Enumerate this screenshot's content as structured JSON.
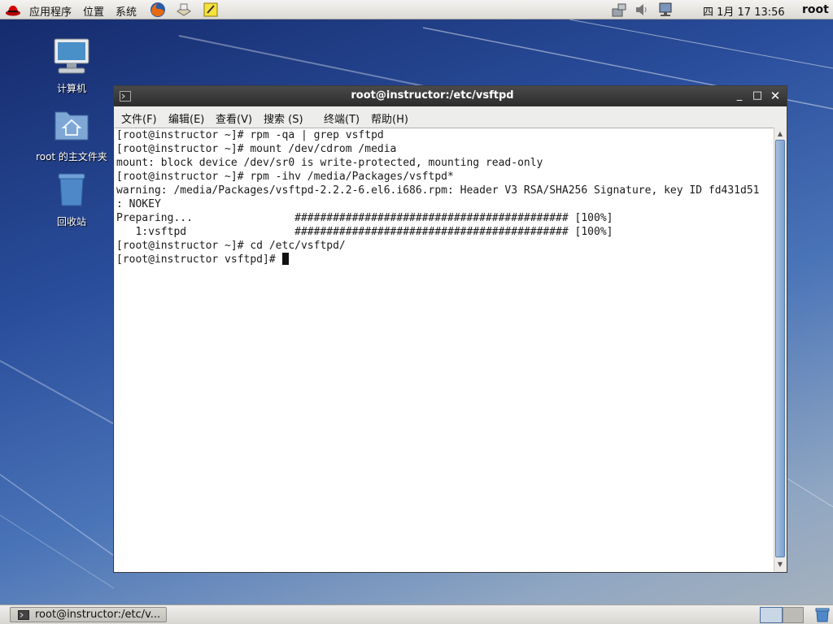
{
  "top_panel": {
    "menus": [
      "应用程序",
      "位置",
      "系统"
    ],
    "clock": "四  1月 17 13:56",
    "user": "root"
  },
  "desktop": {
    "icons": [
      {
        "label": "计算机",
        "icon": "computer-icon"
      },
      {
        "label": "root 的主文件夹",
        "icon": "home-folder-icon"
      },
      {
        "label": "回收站",
        "icon": "trash-icon"
      }
    ]
  },
  "terminal": {
    "title": "root@instructor:/etc/vsftpd",
    "menus": [
      "文件(F)",
      "编辑(E)",
      "查看(V)",
      "搜索 (S)",
      "终端(T)",
      "帮助(H)"
    ],
    "lines": [
      "[root@instructor ~]# rpm -qa | grep vsftpd",
      "[root@instructor ~]# mount /dev/cdrom /media",
      "mount: block device /dev/sr0 is write-protected, mounting read-only",
      "[root@instructor ~]# rpm -ihv /media/Packages/vsftpd*",
      "warning: /media/Packages/vsftpd-2.2.2-6.el6.i686.rpm: Header V3 RSA/SHA256 Signature, key ID fd431d51",
      ": NOKEY",
      "Preparing...                ########################################### [100%]",
      "   1:vsftpd                 ########################################### [100%]",
      "[root@instructor ~]# cd /etc/vsftpd/"
    ],
    "prompt": "[root@instructor vsftpd]# "
  },
  "taskbar": {
    "task_label": "root@instructor:/etc/v..."
  }
}
